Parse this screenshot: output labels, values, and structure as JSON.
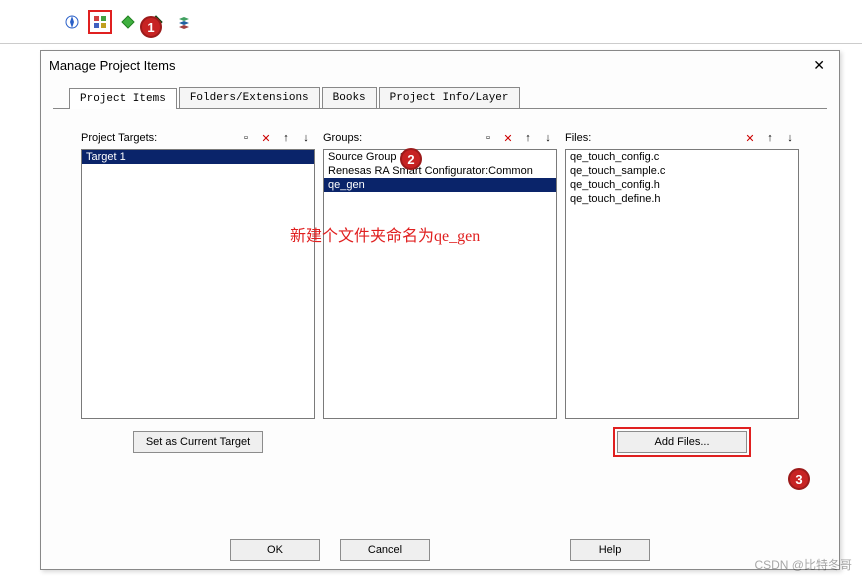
{
  "toolbar_icons": [
    "compass-icon",
    "blocks-icon",
    "diamond-icon",
    "diamond-green-icon",
    "stack-icon"
  ],
  "dialog": {
    "title": "Manage Project Items",
    "close": "✕",
    "tabs": [
      "Project Items",
      "Folders/Extensions",
      "Books",
      "Project Info/Layer"
    ],
    "active_tab": 0
  },
  "targets": {
    "label": "Project Targets:",
    "items": [
      "Target 1"
    ],
    "selected": 0,
    "button": "Set as Current Target"
  },
  "groups": {
    "label": "Groups:",
    "items": [
      "Source Group 1",
      "Renesas RA Smart Configurator:Common",
      "qe_gen"
    ],
    "selected": 2
  },
  "files": {
    "label": "Files:",
    "items": [
      "qe_touch_config.c",
      "qe_touch_sample.c",
      "qe_touch_config.h",
      "qe_touch_define.h"
    ],
    "button": "Add Files..."
  },
  "buttons": {
    "ok": "OK",
    "cancel": "Cancel",
    "help": "Help"
  },
  "annotations": {
    "b1": "1",
    "b2": "2",
    "b3": "3",
    "text": "新建个文件夹命名为qe_gen"
  },
  "icon_btns": {
    "new": "▫",
    "delete": "✕",
    "up": "↑",
    "down": "↓"
  },
  "watermark": "CSDN @比特冬哥"
}
